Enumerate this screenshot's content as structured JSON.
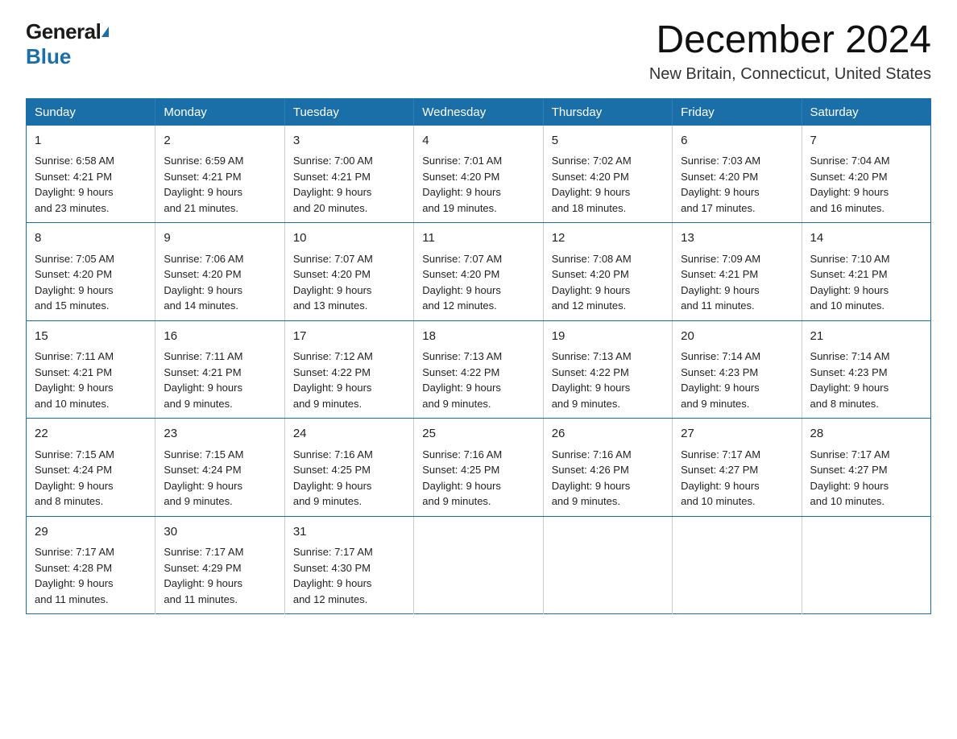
{
  "header": {
    "logo_general": "General",
    "logo_blue": "Blue",
    "month_title": "December 2024",
    "location": "New Britain, Connecticut, United States"
  },
  "weekdays": [
    "Sunday",
    "Monday",
    "Tuesday",
    "Wednesday",
    "Thursday",
    "Friday",
    "Saturday"
  ],
  "weeks": [
    [
      {
        "day": "1",
        "sunrise": "6:58 AM",
        "sunset": "4:21 PM",
        "daylight": "9 hours and 23 minutes."
      },
      {
        "day": "2",
        "sunrise": "6:59 AM",
        "sunset": "4:21 PM",
        "daylight": "9 hours and 21 minutes."
      },
      {
        "day": "3",
        "sunrise": "7:00 AM",
        "sunset": "4:21 PM",
        "daylight": "9 hours and 20 minutes."
      },
      {
        "day": "4",
        "sunrise": "7:01 AM",
        "sunset": "4:20 PM",
        "daylight": "9 hours and 19 minutes."
      },
      {
        "day": "5",
        "sunrise": "7:02 AM",
        "sunset": "4:20 PM",
        "daylight": "9 hours and 18 minutes."
      },
      {
        "day": "6",
        "sunrise": "7:03 AM",
        "sunset": "4:20 PM",
        "daylight": "9 hours and 17 minutes."
      },
      {
        "day": "7",
        "sunrise": "7:04 AM",
        "sunset": "4:20 PM",
        "daylight": "9 hours and 16 minutes."
      }
    ],
    [
      {
        "day": "8",
        "sunrise": "7:05 AM",
        "sunset": "4:20 PM",
        "daylight": "9 hours and 15 minutes."
      },
      {
        "day": "9",
        "sunrise": "7:06 AM",
        "sunset": "4:20 PM",
        "daylight": "9 hours and 14 minutes."
      },
      {
        "day": "10",
        "sunrise": "7:07 AM",
        "sunset": "4:20 PM",
        "daylight": "9 hours and 13 minutes."
      },
      {
        "day": "11",
        "sunrise": "7:07 AM",
        "sunset": "4:20 PM",
        "daylight": "9 hours and 12 minutes."
      },
      {
        "day": "12",
        "sunrise": "7:08 AM",
        "sunset": "4:20 PM",
        "daylight": "9 hours and 12 minutes."
      },
      {
        "day": "13",
        "sunrise": "7:09 AM",
        "sunset": "4:21 PM",
        "daylight": "9 hours and 11 minutes."
      },
      {
        "day": "14",
        "sunrise": "7:10 AM",
        "sunset": "4:21 PM",
        "daylight": "9 hours and 10 minutes."
      }
    ],
    [
      {
        "day": "15",
        "sunrise": "7:11 AM",
        "sunset": "4:21 PM",
        "daylight": "9 hours and 10 minutes."
      },
      {
        "day": "16",
        "sunrise": "7:11 AM",
        "sunset": "4:21 PM",
        "daylight": "9 hours and 9 minutes."
      },
      {
        "day": "17",
        "sunrise": "7:12 AM",
        "sunset": "4:22 PM",
        "daylight": "9 hours and 9 minutes."
      },
      {
        "day": "18",
        "sunrise": "7:13 AM",
        "sunset": "4:22 PM",
        "daylight": "9 hours and 9 minutes."
      },
      {
        "day": "19",
        "sunrise": "7:13 AM",
        "sunset": "4:22 PM",
        "daylight": "9 hours and 9 minutes."
      },
      {
        "day": "20",
        "sunrise": "7:14 AM",
        "sunset": "4:23 PM",
        "daylight": "9 hours and 9 minutes."
      },
      {
        "day": "21",
        "sunrise": "7:14 AM",
        "sunset": "4:23 PM",
        "daylight": "9 hours and 8 minutes."
      }
    ],
    [
      {
        "day": "22",
        "sunrise": "7:15 AM",
        "sunset": "4:24 PM",
        "daylight": "9 hours and 8 minutes."
      },
      {
        "day": "23",
        "sunrise": "7:15 AM",
        "sunset": "4:24 PM",
        "daylight": "9 hours and 9 minutes."
      },
      {
        "day": "24",
        "sunrise": "7:16 AM",
        "sunset": "4:25 PM",
        "daylight": "9 hours and 9 minutes."
      },
      {
        "day": "25",
        "sunrise": "7:16 AM",
        "sunset": "4:25 PM",
        "daylight": "9 hours and 9 minutes."
      },
      {
        "day": "26",
        "sunrise": "7:16 AM",
        "sunset": "4:26 PM",
        "daylight": "9 hours and 9 minutes."
      },
      {
        "day": "27",
        "sunrise": "7:17 AM",
        "sunset": "4:27 PM",
        "daylight": "9 hours and 10 minutes."
      },
      {
        "day": "28",
        "sunrise": "7:17 AM",
        "sunset": "4:27 PM",
        "daylight": "9 hours and 10 minutes."
      }
    ],
    [
      {
        "day": "29",
        "sunrise": "7:17 AM",
        "sunset": "4:28 PM",
        "daylight": "9 hours and 11 minutes."
      },
      {
        "day": "30",
        "sunrise": "7:17 AM",
        "sunset": "4:29 PM",
        "daylight": "9 hours and 11 minutes."
      },
      {
        "day": "31",
        "sunrise": "7:17 AM",
        "sunset": "4:30 PM",
        "daylight": "9 hours and 12 minutes."
      },
      null,
      null,
      null,
      null
    ]
  ],
  "labels": {
    "sunrise": "Sunrise:",
    "sunset": "Sunset:",
    "daylight": "Daylight:"
  }
}
